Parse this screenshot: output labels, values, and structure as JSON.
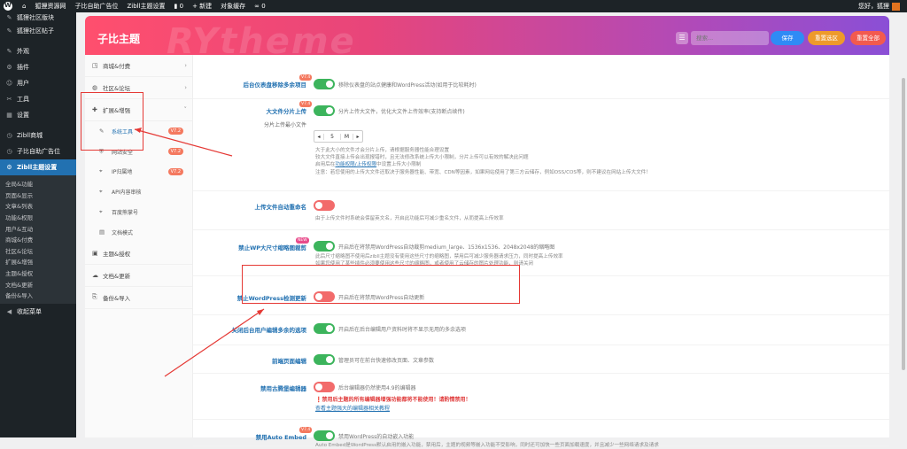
{
  "adminbar": {
    "site_name": "狐狸资源网",
    "items": [
      "子比自助广告位",
      "Zibll主题设置"
    ],
    "comments": "0",
    "new_label": "新建",
    "cache_label": "对象缓存",
    "links_count": "0",
    "greeting": "您好，狐狸"
  },
  "sidebar": {
    "top_items": [
      {
        "label": "狐狸社区版块",
        "icon": "✎"
      },
      {
        "label": "狐狸社区帖子",
        "icon": "✎"
      }
    ],
    "items": [
      {
        "label": "外观",
        "icon": "✎"
      },
      {
        "label": "插件",
        "icon": "⚙"
      },
      {
        "label": "用户",
        "icon": "☺"
      },
      {
        "label": "工具",
        "icon": "✂"
      },
      {
        "label": "设置",
        "icon": "▦"
      }
    ],
    "items2": [
      {
        "label": "Zibll商城",
        "icon": "◷"
      },
      {
        "label": "子比自助广告位",
        "icon": "◷"
      }
    ],
    "active": {
      "label": "Zibll主题设置",
      "icon": "⚙"
    },
    "submenu": [
      "全局&功能",
      "页面&显示",
      "文章&列表",
      "功能&权限",
      "用户&互动",
      "商城&付费",
      "社区&论坛",
      "扩展&增强",
      "主题&授权",
      "文档&更新",
      "备份&导入"
    ],
    "collapse": {
      "label": "收起菜单",
      "icon": "◀"
    }
  },
  "header": {
    "title": "子比主题",
    "watermark": "RYtheme",
    "search_placeholder": "搜索...",
    "save": "保存",
    "reset_section": "重置选区",
    "reset_all": "重置全部"
  },
  "tabs": {
    "top": [
      {
        "label": "商城&付费",
        "icon": "◳"
      },
      {
        "label": "社区&论坛",
        "icon": "◍"
      }
    ],
    "expanded": {
      "label": "扩展&增强",
      "icon": "✚"
    },
    "subtabs": [
      {
        "label": "系统工具",
        "icon": "✎",
        "badge": "V7.2",
        "active": true
      },
      {
        "label": "网站安全",
        "icon": "⛨",
        "badge": "V7.2",
        "active": false
      },
      {
        "label": "IP归属地",
        "icon": "⌖",
        "badge": "V7.2",
        "active": false
      },
      {
        "label": "API内容审核",
        "icon": "⌖",
        "badge": "",
        "active": false
      },
      {
        "label": "百度熊掌号",
        "icon": "⌖",
        "badge": "",
        "active": false
      },
      {
        "label": "文档模式",
        "icon": "▤",
        "badge": "",
        "active": false
      }
    ],
    "bottom": [
      {
        "label": "主题&授权",
        "icon": "▣"
      },
      {
        "label": "文档&更新",
        "icon": "☁"
      },
      {
        "label": "备份&导入",
        "icon": "⎘"
      }
    ]
  },
  "fields": {
    "f1": {
      "label": "后台仪表盘移除多余项目",
      "badge": "V7.4",
      "desc": "移除仪表盘的站点健康和WordPress活动(如用于比较耗时)"
    },
    "f2": {
      "label": "大文件分片上传",
      "badge": "V7.4",
      "desc": "分片上传大文件，优化大文件上传效率(支持断点续传)",
      "sublabel": "分片上传最小文件",
      "stepper": {
        "value": "5",
        "unit": "M"
      },
      "help1": "大于此大小的文件才会分片上传，请根据服务器性能合理设置",
      "help2": "较大文件直接上传会出现报错时，且无法修改系统上传大小限制，分片上传可以有效的解决此问题",
      "help3a": "启用后在",
      "help3link": "功能权限/上传权限",
      "help3b": "中设置上传大小限制",
      "help4": "注意：若您使用的上传大文件还取决于服务器性能、带宽、CDN等因素，如果网站使用了第三方云储存，例如OSS/COS等，则不建议在网站上传大文件！"
    },
    "f3": {
      "label": "上传文件自动重命名",
      "desc": "由于上传文件时系统会保留英文名，开启此功能后可减少重名文件，从而提高上传效率"
    },
    "f4": {
      "label": "禁止WP大尺寸缩略图裁剪",
      "badge": "NEW",
      "desc": "开启后在将禁用WordPress自动裁剪medium_large、1536x1536、2048x2048的缩略图",
      "help1": "此后尺寸缩略图不使用后zibll主题没有使用这些尺寸的缩略图，禁用后可减少服务器请求压力，同时提高上传效率",
      "help2": "如果您使用了某些插件必须要使用这些尺寸的缩略图，或者使用了云储存的图片处理功能，则请关闭"
    },
    "f5": {
      "label": "禁止WordPress检测更新",
      "desc": "开启后在将禁用WordPress自动更新"
    },
    "f6": {
      "label": "关闭后台用户编辑多余的选项",
      "desc": "开启后在后台编辑用户资料时将不显示无用的多余选项"
    },
    "f7": {
      "label": "前端页面编辑",
      "desc": "管理员可在前台快速修改页面、文章参数"
    },
    "f8": {
      "label": "禁用古腾堡编辑器",
      "desc": "后台编辑器仍然使用4.9的编辑器",
      "warn": "禁用后主题的所有编辑器增强功能都将不能使用！请酌情禁用！",
      "link": "查看主题强大的编辑器相关教程"
    },
    "f9": {
      "label": "禁用Auto Embed",
      "badge": "V7.4",
      "desc": "禁用WordPress的自动嵌入功能",
      "help1": "Auto Embed是WordPress默认启用的嵌入功能，禁用后，主题的视频等嵌入功能不受影响，同时还可加快一些页面加载速度，并且减少一些网络请求及请求"
    }
  }
}
